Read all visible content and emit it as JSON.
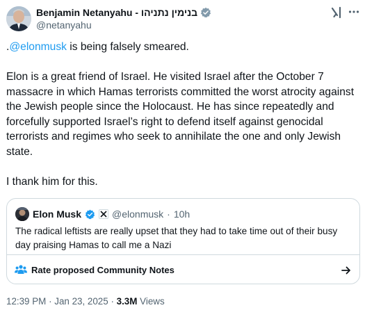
{
  "author": {
    "display_name": "Benjamin Netanyahu - בנימין נתניהו",
    "handle": "@netanyahu",
    "verified_badge": "verified-gray-icon",
    "verified_color": "#829aab"
  },
  "header_actions": {
    "grok_icon": "grok-icon",
    "more_icon": "more-icon"
  },
  "post": {
    "line1_prefix": ".",
    "line1_mention": "@elonmusk",
    "line1_suffix": " is being falsely smeared.",
    "paragraph2": "Elon is a great friend of Israel.  He visited Israel after the October 7 massacre in which Hamas terrorists committed the worst atrocity against the Jewish people since the Holocaust. He has since repeatedly and forcefully supported Israel’s right to defend itself against genocidal terrorists and regimes who seek to annihilate the one and only Jewish state.",
    "paragraph3": "I thank him for this."
  },
  "quote": {
    "display_name": "Elon Musk",
    "verified_color": "#1d9bf0",
    "affiliate_badge": "x-logo-icon",
    "handle": "@elonmusk",
    "separator": "·",
    "time": "10h",
    "text": "The radical leftists are really upset that they had to take time out of their busy day praising Hamas to call me a Nazi"
  },
  "community_notes": {
    "label": "Rate proposed Community Notes",
    "icon": "community-notes-icon",
    "arrow": "arrow-right-icon"
  },
  "meta": {
    "time": "12:39 PM",
    "sep1": "·",
    "date": "Jan 23, 2025",
    "sep2": "·",
    "views_count": "3.3M",
    "views_label": "Views"
  },
  "colors": {
    "link": "#1d9bf0",
    "muted": "#536471",
    "border": "#cfd9de",
    "text": "#0f1419"
  }
}
